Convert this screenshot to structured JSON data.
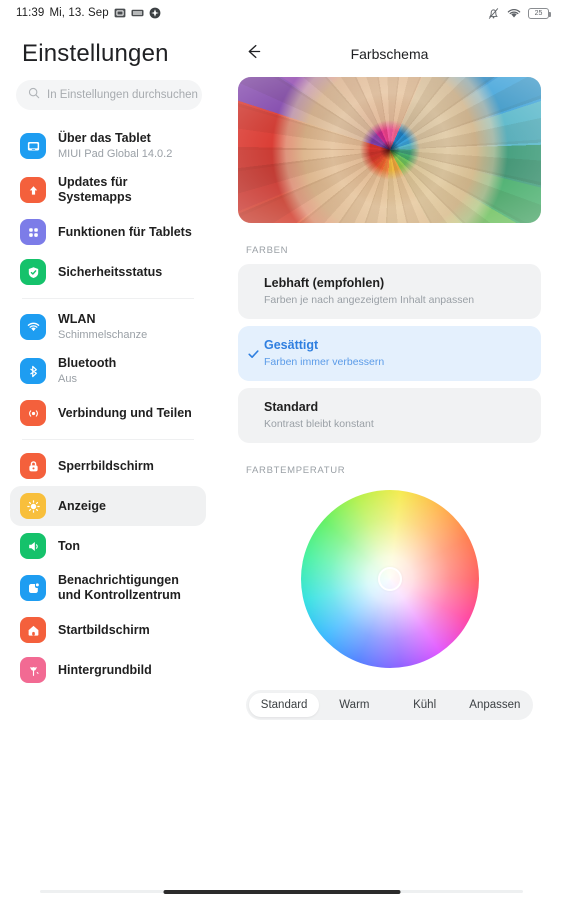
{
  "status_bar": {
    "time": "11:39",
    "date": "Mi, 13. Sep",
    "left_icons": [
      "screenshot-icon",
      "keyboard-icon",
      "location-icon"
    ],
    "right_icons": [
      "notifications-off-icon",
      "wifi-icon"
    ],
    "battery_level": "25"
  },
  "sidebar": {
    "title": "Einstellungen",
    "search": {
      "placeholder": "In Einstellungen durchsuchen",
      "value": ""
    },
    "groups": [
      {
        "items": [
          {
            "label": "Über das Tablet",
            "sub": "MIUI Pad Global 14.0.2",
            "icon": "tablet-icon",
            "color": "#1e9df1",
            "selected": false
          },
          {
            "label": "Updates für Systemapps",
            "sub": "",
            "icon": "arrow-up-icon",
            "color": "#f4603c",
            "selected": false
          },
          {
            "label": "Funktionen für Tablets",
            "sub": "",
            "icon": "grid-icon",
            "color": "#7c7ce8",
            "selected": false
          },
          {
            "label": "Sicherheitsstatus",
            "sub": "",
            "icon": "shield-check-icon",
            "color": "#15c26b",
            "selected": false
          }
        ]
      },
      {
        "items": [
          {
            "label": "WLAN",
            "sub": "Schimmelschanze",
            "icon": "wifi-icon",
            "color": "#1e9df1",
            "selected": false
          },
          {
            "label": "Bluetooth",
            "sub": "Aus",
            "icon": "bluetooth-icon",
            "color": "#1e9df1",
            "selected": false
          },
          {
            "label": "Verbindung und Teilen",
            "sub": "",
            "icon": "share-icon",
            "color": "#f4603c",
            "selected": false
          }
        ]
      },
      {
        "items": [
          {
            "label": "Sperrbildschirm",
            "sub": "",
            "icon": "lock-icon",
            "color": "#f4603c",
            "selected": false
          },
          {
            "label": "Anzeige",
            "sub": "",
            "icon": "brightness-icon",
            "color": "#f8bf3c",
            "selected": true
          },
          {
            "label": "Ton",
            "sub": "",
            "icon": "speaker-icon",
            "color": "#15c26b",
            "selected": false
          },
          {
            "label": "Benachrichtigungen und Kontrollzentrum",
            "sub": "",
            "icon": "notification-icon",
            "color": "#1e9df1",
            "selected": false
          },
          {
            "label": "Startbildschirm",
            "sub": "",
            "icon": "home-icon",
            "color": "#f4603c",
            "selected": false
          },
          {
            "label": "Hintergrundbild",
            "sub": "",
            "icon": "flower-icon",
            "color": "#f26a93",
            "selected": false
          }
        ]
      }
    ]
  },
  "pane": {
    "back_label": "back-arrow",
    "title": "Farbschema",
    "hero_alt": "colored-pencils-photo",
    "colors_section": {
      "label": "FARBEN",
      "options": [
        {
          "title": "Lebhaft (empfohlen)",
          "sub": "Farben je nach angezeigtem Inhalt anpassen",
          "selected": false
        },
        {
          "title": "Gesättigt",
          "sub": "Farben immer verbessern",
          "selected": true
        },
        {
          "title": "Standard",
          "sub": "Kontrast bleibt konstant",
          "selected": false
        }
      ]
    },
    "temperature_section": {
      "label": "FARBTEMPERATUR",
      "tabs": [
        {
          "label": "Standard",
          "active": true
        },
        {
          "label": "Warm",
          "active": false
        },
        {
          "label": "Kühl",
          "active": false
        },
        {
          "label": "Anpassen",
          "active": false
        }
      ]
    }
  },
  "theme": {
    "accent_blue": "#2f7fe0",
    "accent_blue_bg": "#e4f0fd",
    "option_bg": "#f1f2f3",
    "selected_nav_bg": "#f0f1f2"
  }
}
